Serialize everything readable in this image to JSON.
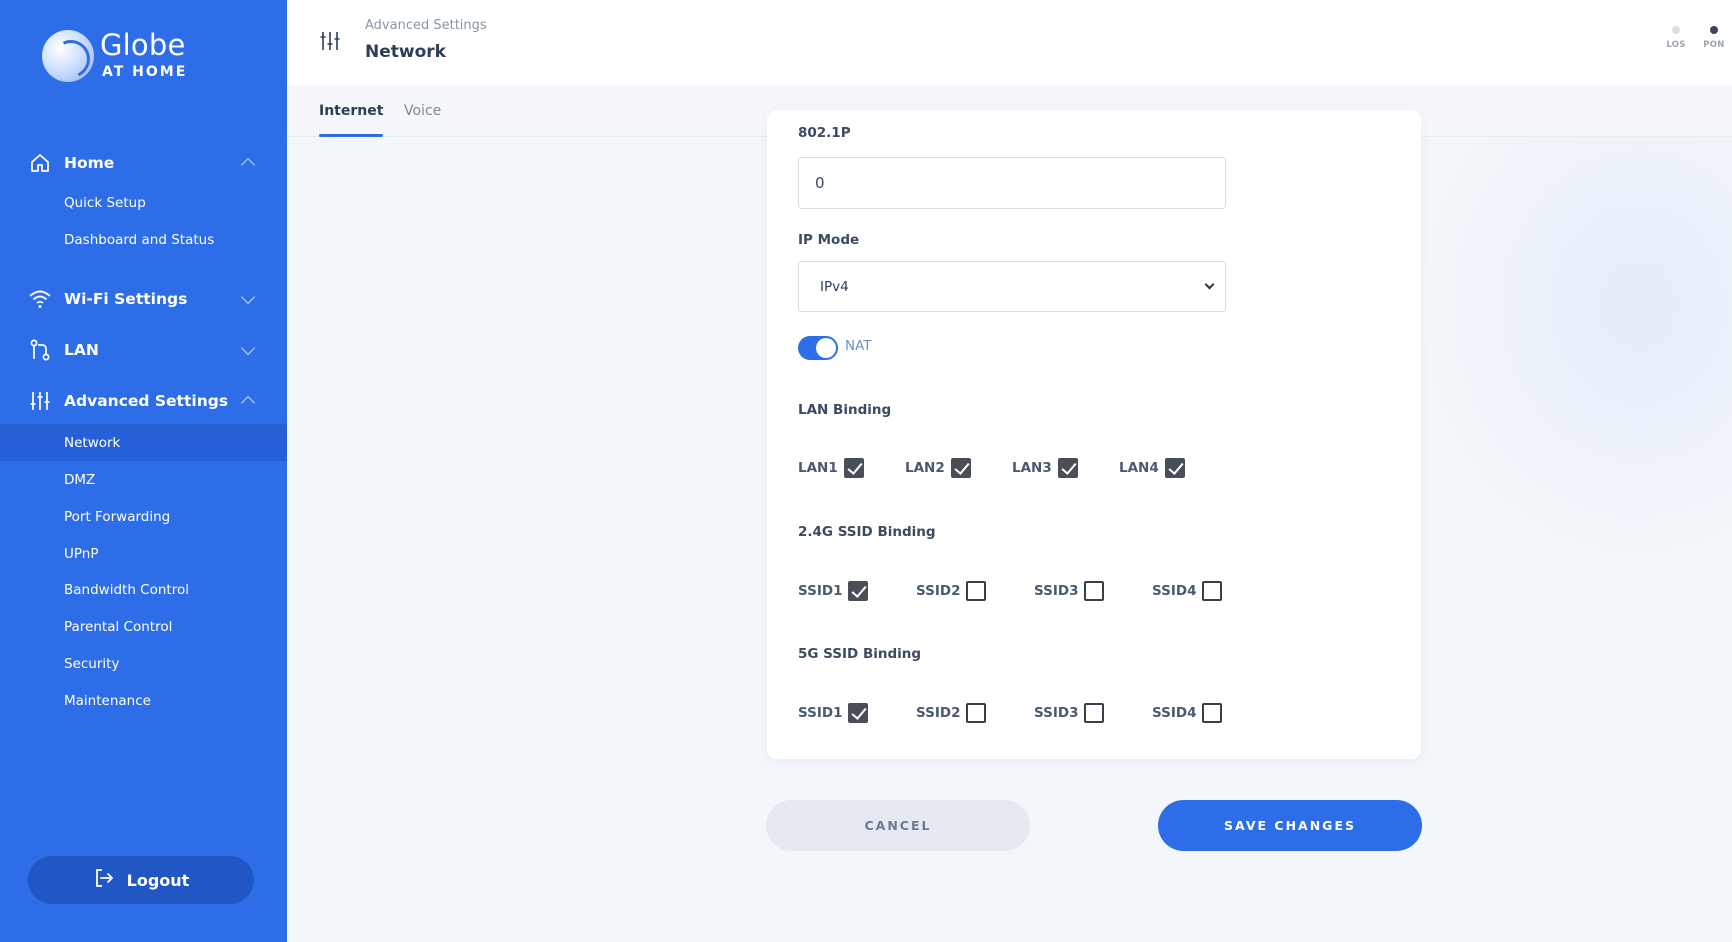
{
  "brand": {
    "name": "Globe",
    "sub": "AT HOME"
  },
  "sidebar": {
    "groups": {
      "home": {
        "label": "Home",
        "items": [
          "Quick Setup",
          "Dashboard and Status"
        ]
      },
      "wifi": {
        "label": "Wi-Fi Settings"
      },
      "lan": {
        "label": "LAN"
      },
      "advanced": {
        "label": "Advanced Settings",
        "items": [
          "Network",
          "DMZ",
          "Port Forwarding",
          "UPnP",
          "Bandwidth Control",
          "Parental Control",
          "Security",
          "Maintenance"
        ]
      }
    },
    "logout": "Logout"
  },
  "header": {
    "breadcrumb": "Advanced Settings",
    "title": "Network",
    "status": [
      {
        "label": "LOS",
        "color": "#d9dee6"
      },
      {
        "label": "PON",
        "color": "#3a4556"
      }
    ]
  },
  "tabs": [
    "Internet",
    "Voice"
  ],
  "form": {
    "priority_label": "802.1P",
    "priority_value": "0",
    "ip_mode_label": "IP Mode",
    "ip_mode_value": "IPv4",
    "nat_label": "NAT",
    "nat_on": true,
    "lan_binding_label": "LAN Binding",
    "lan_binding": [
      {
        "label": "LAN1",
        "checked": true
      },
      {
        "label": "LAN2",
        "checked": true
      },
      {
        "label": "LAN3",
        "checked": true
      },
      {
        "label": "LAN4",
        "checked": true
      }
    ],
    "ssid24_label": "2.4G SSID Binding",
    "ssid24": [
      {
        "label": "SSID1",
        "checked": true
      },
      {
        "label": "SSID2",
        "checked": false
      },
      {
        "label": "SSID3",
        "checked": false
      },
      {
        "label": "SSID4",
        "checked": false
      }
    ],
    "ssid5_label": "5G SSID Binding",
    "ssid5": [
      {
        "label": "SSID1",
        "checked": true
      },
      {
        "label": "SSID2",
        "checked": false
      },
      {
        "label": "SSID3",
        "checked": false
      },
      {
        "label": "SSID4",
        "checked": false
      }
    ]
  },
  "buttons": {
    "cancel": "CANCEL",
    "save": "SAVE CHANGES"
  },
  "colors": {
    "sidebar": "#2e6de8",
    "accent": "#2e6de8",
    "active_item": "#2660d6"
  }
}
